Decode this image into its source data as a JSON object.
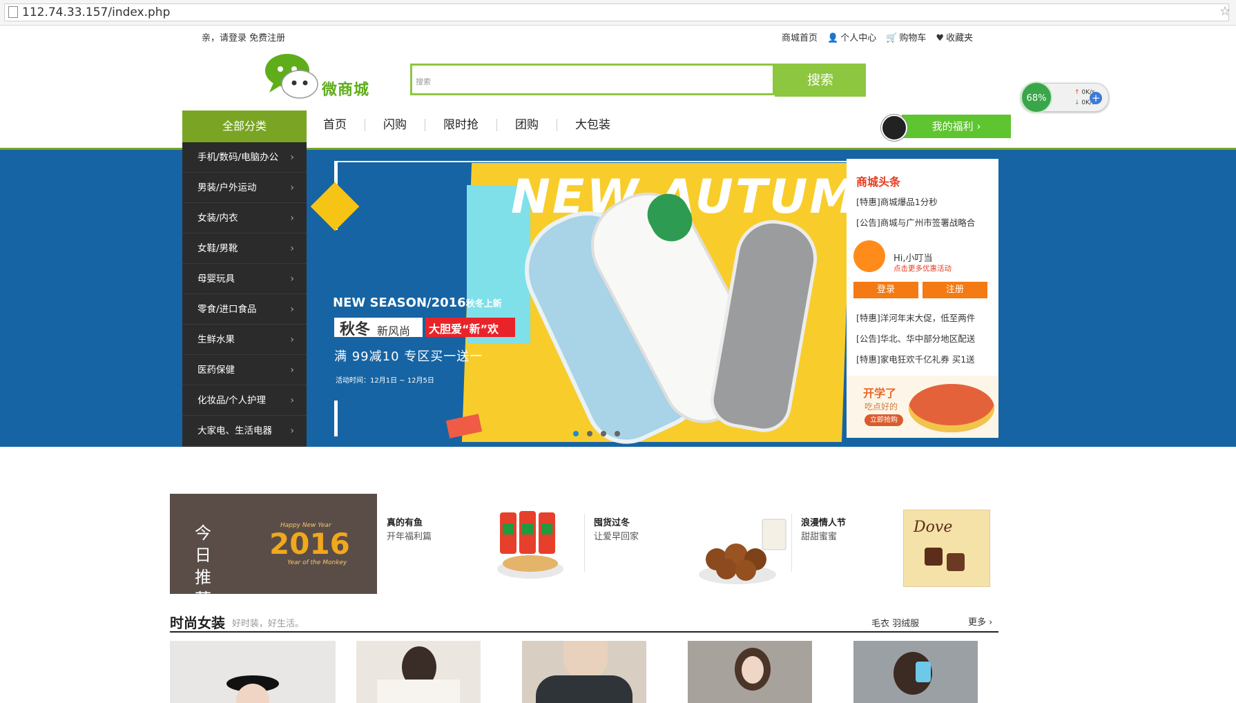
{
  "browser": {
    "url": "112.74.33.157/index.php"
  },
  "topbar": {
    "login_text": "亲，请登录 免费注册",
    "nav": [
      {
        "label": "商城首页",
        "icon": ""
      },
      {
        "label": "个人中心",
        "icon": "user-icon"
      },
      {
        "label": "购物车",
        "icon": "cart-icon"
      },
      {
        "label": "收藏夹",
        "icon": "heart-icon"
      }
    ]
  },
  "logo": {
    "text": "微商城"
  },
  "search": {
    "placeholder": "搜索",
    "button_label": "搜索"
  },
  "speed_widget": {
    "percent": "68%",
    "up": "0K/s",
    "down": "0K/s"
  },
  "nav": {
    "all_categories": "全部分类",
    "items": [
      "首页",
      "闪购",
      "限时抢",
      "团购",
      "大包装"
    ],
    "welfare": "我的福利 ›"
  },
  "categories": [
    "手机/数码/电脑办公",
    "男装/户外运动",
    "女装/内衣",
    "女鞋/男靴",
    "母婴玩具",
    "零食/进口食品",
    "生鲜水果",
    "医药保健",
    "化妆品/个人护理",
    "大家电、生活电器"
  ],
  "banner": {
    "headline": "NEW AUTUMN",
    "season": "NEW SEASON/2016",
    "season_cn": "秋冬上新",
    "qiudong": "秋冬",
    "xinfengshang": "新风尚",
    "dadan": "大胆爱“新”欢",
    "promo": "满 99减10 专区买一送一",
    "time": "活动时间：12月1日 ~ 12月5日",
    "dots": 4,
    "active_dot": 0
  },
  "news": {
    "title": "商城头条",
    "top": [
      "[特惠]商城爆品1分秒",
      "[公告]商城与广州市签署战略合"
    ],
    "user_greeting": "Hi,小叮当",
    "user_hint": "点击更多优惠活动",
    "login": "登录",
    "register": "注册",
    "bottom": [
      "[特惠]洋河年末大促，低至两件",
      "[公告]华北、华中部分地区配送",
      "[特惠]家电狂欢千亿礼券 买1送"
    ],
    "promo_title": "开学了",
    "promo_sub": "吃点好的",
    "promo_btn": "立即抢购"
  },
  "recommend": {
    "today": "今日推荐",
    "year": "2016",
    "happy_new_year": "Happy New Year",
    "year_of_monkey": "Year of the Monkey",
    "items": [
      {
        "title": "真的有鱼",
        "sub": "开年福利篇"
      },
      {
        "title": "囤货过冬",
        "sub": "让爱早回家"
      },
      {
        "title": "浪漫情人节",
        "sub": "甜甜蜜蜜"
      }
    ],
    "dove_label": "Dove"
  },
  "section": {
    "title": "时尚女装",
    "subtitle": "好时装，好生活。",
    "links": "毛衣 羽绒服",
    "more": "更多 ›"
  },
  "colors": {
    "accent_green": "#8dc63f",
    "banner_blue": "#1664a3",
    "news_red": "#e63c20",
    "button_orange": "#f47a14"
  }
}
